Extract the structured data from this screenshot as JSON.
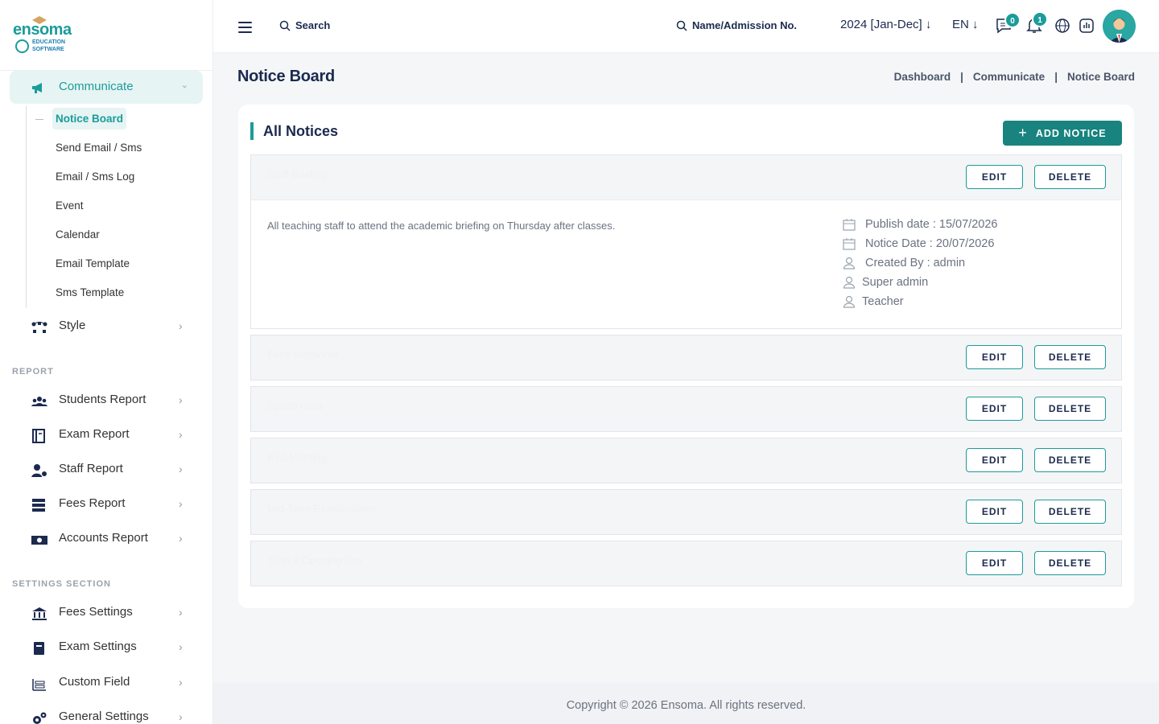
{
  "brand": {
    "name": "ensoma",
    "sub1": "EDUCATION",
    "sub2": "SOFTWARE"
  },
  "sidebar": {
    "active_menu": "Communicate",
    "sub_items": [
      "Notice Board",
      "Send Email / Sms",
      "Email / Sms Log",
      "Event",
      "Calendar",
      "Email Template",
      "Sms Template"
    ],
    "style_label": "Style",
    "report_section": "REPORT",
    "report_items": [
      "Students Report",
      "Exam Report",
      "Staff Report",
      "Fees Report",
      "Accounts Report"
    ],
    "settings_section": "SETTINGS SECTION",
    "settings_items": [
      "Fees Settings",
      "Exam Settings",
      "Custom Field",
      "General Settings"
    ]
  },
  "header": {
    "search_label": "Search",
    "search2_label": "Name/Admission No.",
    "year": "2024 [Jan-Dec]",
    "lang": "EN",
    "messages_count": "0",
    "notifications_count": "1"
  },
  "page": {
    "title": "Notice Board",
    "breadcrumbs": [
      "Dashboard",
      "Communicate",
      "Notice Board"
    ]
  },
  "card": {
    "title": "All Notices",
    "add_label": "ADD NOTICE",
    "edit_label": "EDIT",
    "delete_label": "DELETE"
  },
  "notices": [
    {
      "title": "Staff Briefing",
      "description": "All teaching staff to attend the academic briefing on Thursday after classes.",
      "publish_date": "Publish date : 15/07/2026",
      "notice_date": "Notice Date : 20/07/2026",
      "created_by": "Created By : admin",
      "roles": [
        "Super admin",
        "Teacher"
      ]
    },
    {
      "title": "Fees Reminder"
    },
    {
      "title": "Sports Gala"
    },
    {
      "title": "PTA Meeting"
    },
    {
      "title": "Mid-Term Examinations"
    },
    {
      "title": "Term 2 Opening Day"
    }
  ],
  "footer": {
    "copyright": "Copyright © 2026 Ensoma. All rights reserved."
  },
  "colors": {
    "accent": "#1b9c9a",
    "button": "#18837f",
    "heading": "#1b2a4e"
  }
}
